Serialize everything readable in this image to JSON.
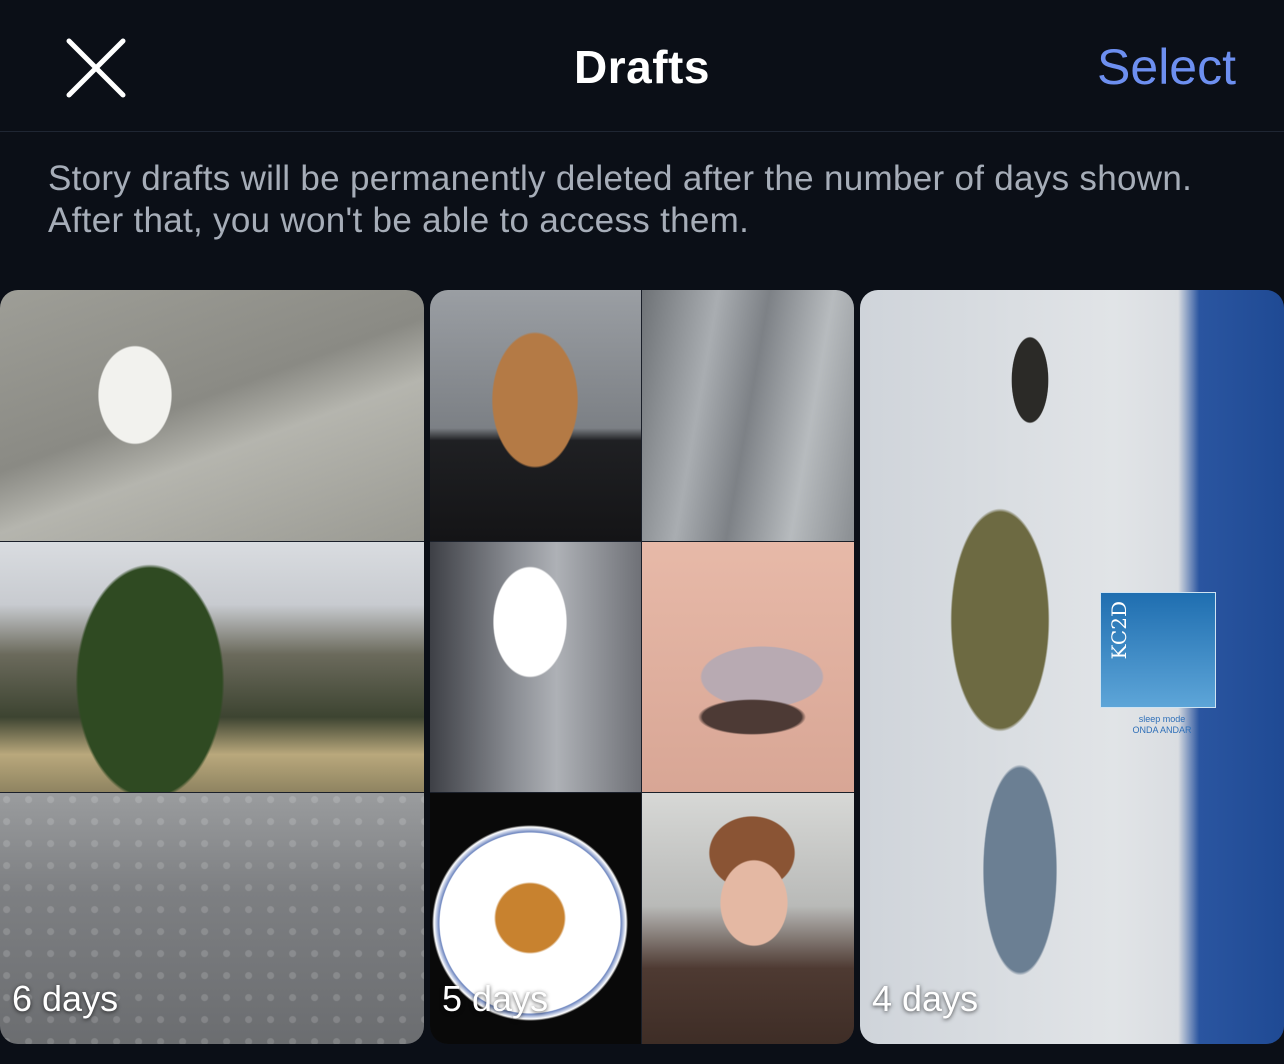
{
  "header": {
    "close_icon": "close-icon",
    "title": "Drafts",
    "select_label": "Select"
  },
  "notice": "Story drafts will be permanently deleted after the number of days shown. After that, you won't be able to access them.",
  "drafts": [
    {
      "days_label": "6 days"
    },
    {
      "days_label": "5 days"
    },
    {
      "days_label": "4 days",
      "sticker": {
        "text": "KC2D",
        "caption_line1": "sleep mode",
        "caption_line2": "ONDA ANDAR"
      }
    }
  ],
  "colors": {
    "background": "#0b0f17",
    "accent": "#6d8ff0",
    "notice_text": "#a6adb8"
  }
}
